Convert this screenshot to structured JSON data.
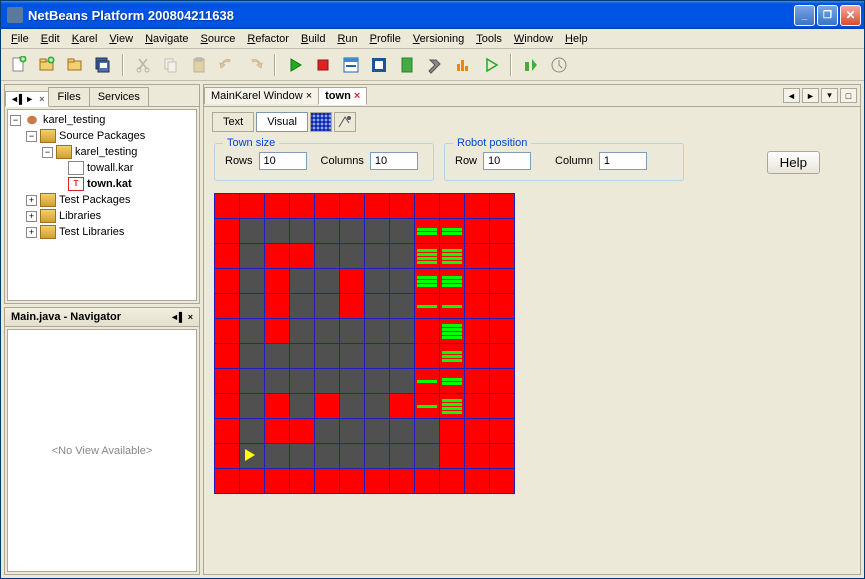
{
  "window": {
    "title": "NetBeans Platform 200804211638"
  },
  "menu": [
    "File",
    "Edit",
    "Karel",
    "View",
    "Navigate",
    "Source",
    "Refactor",
    "Build",
    "Run",
    "Profile",
    "Versioning",
    "Tools",
    "Window",
    "Help"
  ],
  "left_tabs": {
    "mini_label": "",
    "files": "Files",
    "services": "Services"
  },
  "tree": {
    "root": "karel_testing",
    "src_pkg": "Source Packages",
    "pkg": "karel_testing",
    "file1": "towall.kar",
    "file2": "town.kat",
    "test_pkg": "Test Packages",
    "libs": "Libraries",
    "test_libs": "Test Libraries"
  },
  "navigator": {
    "title": "Main.java - Navigator",
    "empty": "<No View Available>"
  },
  "editor_tabs": {
    "tab1": "MainKarel Window",
    "tab2": "town"
  },
  "view": {
    "text": "Text",
    "visual": "Visual"
  },
  "town_size": {
    "legend": "Town size",
    "rows_label": "Rows",
    "rows_value": "10",
    "cols_label": "Columns",
    "cols_value": "10"
  },
  "robot_pos": {
    "legend": "Robot position",
    "row_label": "Row",
    "row_value": "10",
    "col_label": "Column",
    "col_value": "1"
  },
  "help": "Help",
  "grid": {
    "rows": 12,
    "cols": 12,
    "walls": [
      [
        1,
        1
      ],
      [
        1,
        2
      ],
      [
        1,
        3
      ],
      [
        1,
        4
      ],
      [
        1,
        5
      ],
      [
        1,
        6
      ],
      [
        1,
        7
      ],
      [
        2,
        1
      ],
      [
        2,
        4
      ],
      [
        2,
        5
      ],
      [
        2,
        6
      ],
      [
        2,
        7
      ],
      [
        3,
        1
      ],
      [
        3,
        3
      ],
      [
        3,
        4
      ],
      [
        3,
        6
      ],
      [
        3,
        7
      ],
      [
        4,
        1
      ],
      [
        4,
        3
      ],
      [
        4,
        4
      ],
      [
        4,
        6
      ],
      [
        4,
        7
      ],
      [
        5,
        1
      ],
      [
        5,
        3
      ],
      [
        5,
        4
      ],
      [
        5,
        5
      ],
      [
        5,
        6
      ],
      [
        5,
        7
      ],
      [
        6,
        1
      ],
      [
        6,
        2
      ],
      [
        6,
        3
      ],
      [
        6,
        4
      ],
      [
        6,
        5
      ],
      [
        6,
        6
      ],
      [
        6,
        7
      ],
      [
        7,
        1
      ],
      [
        7,
        2
      ],
      [
        7,
        3
      ],
      [
        7,
        4
      ],
      [
        7,
        5
      ],
      [
        7,
        6
      ],
      [
        7,
        7
      ],
      [
        8,
        1
      ],
      [
        8,
        3
      ],
      [
        8,
        5
      ],
      [
        8,
        6
      ],
      [
        9,
        1
      ],
      [
        9,
        4
      ],
      [
        9,
        5
      ],
      [
        9,
        6
      ],
      [
        9,
        7
      ],
      [
        9,
        8
      ],
      [
        10,
        1
      ],
      [
        10,
        2
      ],
      [
        10,
        3
      ],
      [
        10,
        4
      ],
      [
        10,
        5
      ],
      [
        10,
        6
      ],
      [
        10,
        7
      ],
      [
        10,
        8
      ]
    ],
    "beepers": {
      "1,8": 2,
      "1,9": 2,
      "2,8": 4,
      "2,9": 4,
      "3,8": 3,
      "3,9": 3,
      "4,8": 1,
      "4,9": 1,
      "5,9": 4,
      "6,9": 3,
      "7,8": 1,
      "7,9": 2,
      "8,8": 1,
      "8,9": 4
    },
    "robot": [
      10,
      1
    ]
  }
}
